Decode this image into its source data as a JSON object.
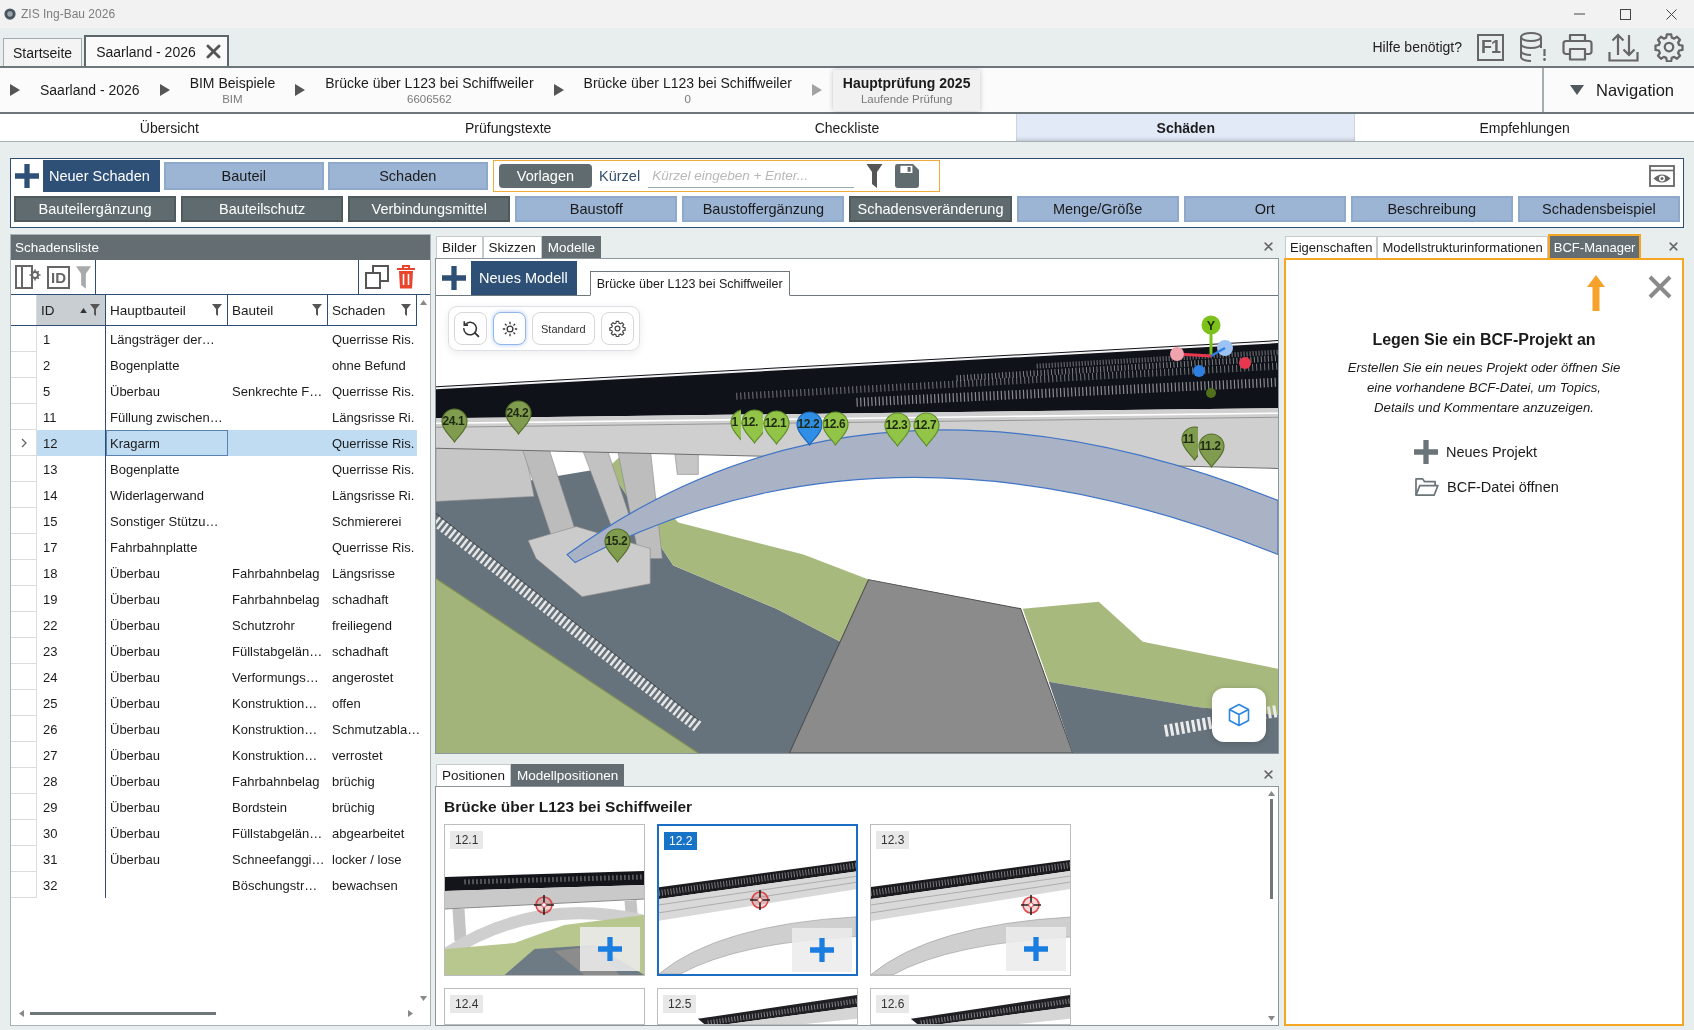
{
  "window": {
    "title": "ZIS Ing-Bau 2026"
  },
  "document_tabs": [
    {
      "label": "Startseite",
      "selected": false,
      "closable": false
    },
    {
      "label": "Saarland - 2026",
      "selected": true,
      "closable": true
    }
  ],
  "help": {
    "label": "Hilfe benötigt?",
    "key": "F1"
  },
  "breadcrumbs": [
    {
      "title": "Saarland - 2026",
      "selected": false
    },
    {
      "title": "BIM Beispiele",
      "subtitle": "BIM",
      "selected": false
    },
    {
      "title": "Brücke über L123 bei Schiffweiler",
      "subtitle": "6606562",
      "selected": false
    },
    {
      "title": "Brücke über L123 bei Schiffweiler",
      "subtitle": "0",
      "selected": false
    },
    {
      "title": "Hauptprüfung 2025",
      "subtitle": "Laufende Prüfung",
      "selected": true
    }
  ],
  "navigation": {
    "label": "Navigation"
  },
  "section_tabs": [
    {
      "label": "Übersicht",
      "selected": false
    },
    {
      "label": "Prüfungstexte",
      "selected": false
    },
    {
      "label": "Checkliste",
      "selected": false
    },
    {
      "label": "Schäden",
      "selected": true
    },
    {
      "label": "Empfehlungen",
      "selected": false
    }
  ],
  "toolbar": {
    "new_button": "Neuer Schaden",
    "toggle_buttons": [
      {
        "label": "Bauteil",
        "active": false
      },
      {
        "label": "Schaden",
        "active": false
      }
    ],
    "templates_button": "Vorlagen",
    "shortcut_field": {
      "label": "Kürzel",
      "placeholder": "Kürzel eingeben + Enter..."
    },
    "category_buttons": [
      {
        "label": "Bauteilergänzung",
        "active": true
      },
      {
        "label": "Bauteilschutz",
        "active": true
      },
      {
        "label": "Verbindungsmittel",
        "active": true
      },
      {
        "label": "Baustoff",
        "active": false
      },
      {
        "label": "Baustoffergänzung",
        "active": false
      },
      {
        "label": "Schadensveränderung",
        "active": true
      },
      {
        "label": "Menge/Größe",
        "active": false
      },
      {
        "label": "Ort",
        "active": false
      },
      {
        "label": "Beschreibung",
        "active": false
      },
      {
        "label": "Schadensbeispiel",
        "active": false
      }
    ]
  },
  "damage_list": {
    "title": "Schadensliste",
    "id_toggle": "ID",
    "columns": [
      {
        "label": "ID",
        "sorted": true
      },
      {
        "label": "Hauptbauteil",
        "sorted": false
      },
      {
        "label": "Bauteil",
        "sorted": false
      },
      {
        "label": "Schaden",
        "sorted": false
      }
    ],
    "rows": [
      {
        "id": "1",
        "main_component": "Längsträger der…",
        "damage": "Querrisse Ris.",
        "selected": false
      },
      {
        "id": "2",
        "main_component": "Bogenplatte",
        "damage": "ohne Befund",
        "selected": false
      },
      {
        "id": "5",
        "main_component": "Überbau",
        "component": "Senkrechte F…",
        "damage": "Querrisse Ris.",
        "selected": false
      },
      {
        "id": "11",
        "main_component": "Füllung zwischen…",
        "damage": "Längsrisse Ri.",
        "selected": false
      },
      {
        "id": "12",
        "main_component": "Kragarm",
        "damage": "Querrisse Ris.",
        "selected": true
      },
      {
        "id": "13",
        "main_component": "Bogenplatte",
        "damage": "Querrisse Ris.",
        "selected": false
      },
      {
        "id": "14",
        "main_component": "Widerlagerwand",
        "damage": "Längsrisse Ri.",
        "selected": false
      },
      {
        "id": "15",
        "main_component": "Sonstiger Stützu…",
        "damage": "Schmiererei",
        "selected": false
      },
      {
        "id": "17",
        "main_component": "Fahrbahnplatte",
        "damage": "Querrisse Ris.",
        "selected": false
      },
      {
        "id": "18",
        "main_component": "Überbau",
        "component": "Fahrbahnbelag",
        "damage": "Längsrisse",
        "selected": false
      },
      {
        "id": "19",
        "main_component": "Überbau",
        "component": "Fahrbahnbelag",
        "damage": "schadhaft",
        "selected": false
      },
      {
        "id": "22",
        "main_component": "Überbau",
        "component": "Schutzrohr",
        "damage": "freiliegend",
        "selected": false
      },
      {
        "id": "23",
        "main_component": "Überbau",
        "component": "Füllstabgelän…",
        "damage": "schadhaft",
        "selected": false
      },
      {
        "id": "24",
        "main_component": "Überbau",
        "component": "Verformungs…",
        "damage": "angerostet",
        "selected": false
      },
      {
        "id": "25",
        "main_component": "Überbau",
        "component": "Konstruktion…",
        "damage": "offen",
        "selected": false
      },
      {
        "id": "26",
        "main_component": "Überbau",
        "component": "Konstruktion…",
        "damage": "Schmutzabla…",
        "selected": false
      },
      {
        "id": "27",
        "main_component": "Überbau",
        "component": "Konstruktion…",
        "damage": "verrostet",
        "selected": false
      },
      {
        "id": "28",
        "main_component": "Überbau",
        "component": "Fahrbahnbelag",
        "damage": "brüchig",
        "selected": false
      },
      {
        "id": "29",
        "main_component": "Überbau",
        "component": "Bordstein",
        "damage": "brüchig",
        "selected": false
      },
      {
        "id": "30",
        "main_component": "Überbau",
        "component": "Füllstabgelän…",
        "damage": "abgearbeitet",
        "selected": false
      },
      {
        "id": "31",
        "main_component": "Überbau",
        "component": "Schneefanggi…",
        "damage": "locker / lose",
        "selected": false
      },
      {
        "id": "32",
        "component": "Böschungstr…",
        "damage": "bewachsen",
        "selected": false
      }
    ]
  },
  "model_panel": {
    "tabs": [
      {
        "label": "Bilder",
        "selected": false
      },
      {
        "label": "Skizzen",
        "selected": false
      },
      {
        "label": "Modelle",
        "selected": true
      }
    ],
    "new_button": "Neues Modell",
    "model_tabs": [
      {
        "label": "Brücke über L123 bei Schiffweiler",
        "selected": true
      }
    ],
    "viewer_toolbar": {
      "lighting": true,
      "preset": "Standard"
    },
    "gizmo_label": "Y",
    "pins": [
      {
        "label": "24.1",
        "selected": false,
        "dimmed": true
      },
      {
        "label": "24.2",
        "selected": false,
        "dimmed": true
      },
      {
        "label": "1",
        "selected": false,
        "dimmed": false
      },
      {
        "label": "12.",
        "selected": false,
        "dimmed": false
      },
      {
        "label": "12.1",
        "selected": false,
        "dimmed": false
      },
      {
        "label": "12.2",
        "selected": true,
        "dimmed": false
      },
      {
        "label": "12.6",
        "selected": false,
        "dimmed": false
      },
      {
        "label": "12.3",
        "selected": false,
        "dimmed": false
      },
      {
        "label": "12.7",
        "selected": false,
        "dimmed": false
      },
      {
        "label": "11",
        "selected": false,
        "dimmed": true
      },
      {
        "label": "11.2",
        "selected": false,
        "dimmed": true
      },
      {
        "label": "15.2",
        "selected": false,
        "dimmed": true
      }
    ]
  },
  "positions_panel": {
    "tabs": [
      {
        "label": "Positionen",
        "selected": false
      },
      {
        "label": "Modellpositionen",
        "selected": true
      }
    ],
    "title": "Brücke über L123 bei Schiffweiler",
    "cards": [
      {
        "label": "12.1",
        "selected": false,
        "kind": "overview"
      },
      {
        "label": "12.2",
        "selected": true,
        "kind": "detail"
      },
      {
        "label": "12.3",
        "selected": false,
        "kind": "detail"
      },
      {
        "label": "12.4",
        "selected": false,
        "kind": "blank"
      },
      {
        "label": "12.5",
        "selected": false,
        "kind": "steep"
      },
      {
        "label": "12.6",
        "selected": false,
        "kind": "steep"
      }
    ]
  },
  "bcf_panel": {
    "tabs": [
      {
        "label": "Eigenschaften",
        "selected": false
      },
      {
        "label": "Modellstrukturinformationen",
        "selected": false
      },
      {
        "label": "BCF-Manager",
        "selected": true
      }
    ],
    "heading": "Legen Sie ein BCF-Projekt an",
    "description": "Erstellen Sie ein neues Projekt oder öffnen Sie\neine vorhandene BCF-Datei, um Topics,\nDetails und Kommentare anzuzeigen.",
    "actions": [
      {
        "label": "Neues Projekt",
        "kind": "new"
      },
      {
        "label": "BCF-Datei öffnen",
        "kind": "open"
      }
    ]
  }
}
